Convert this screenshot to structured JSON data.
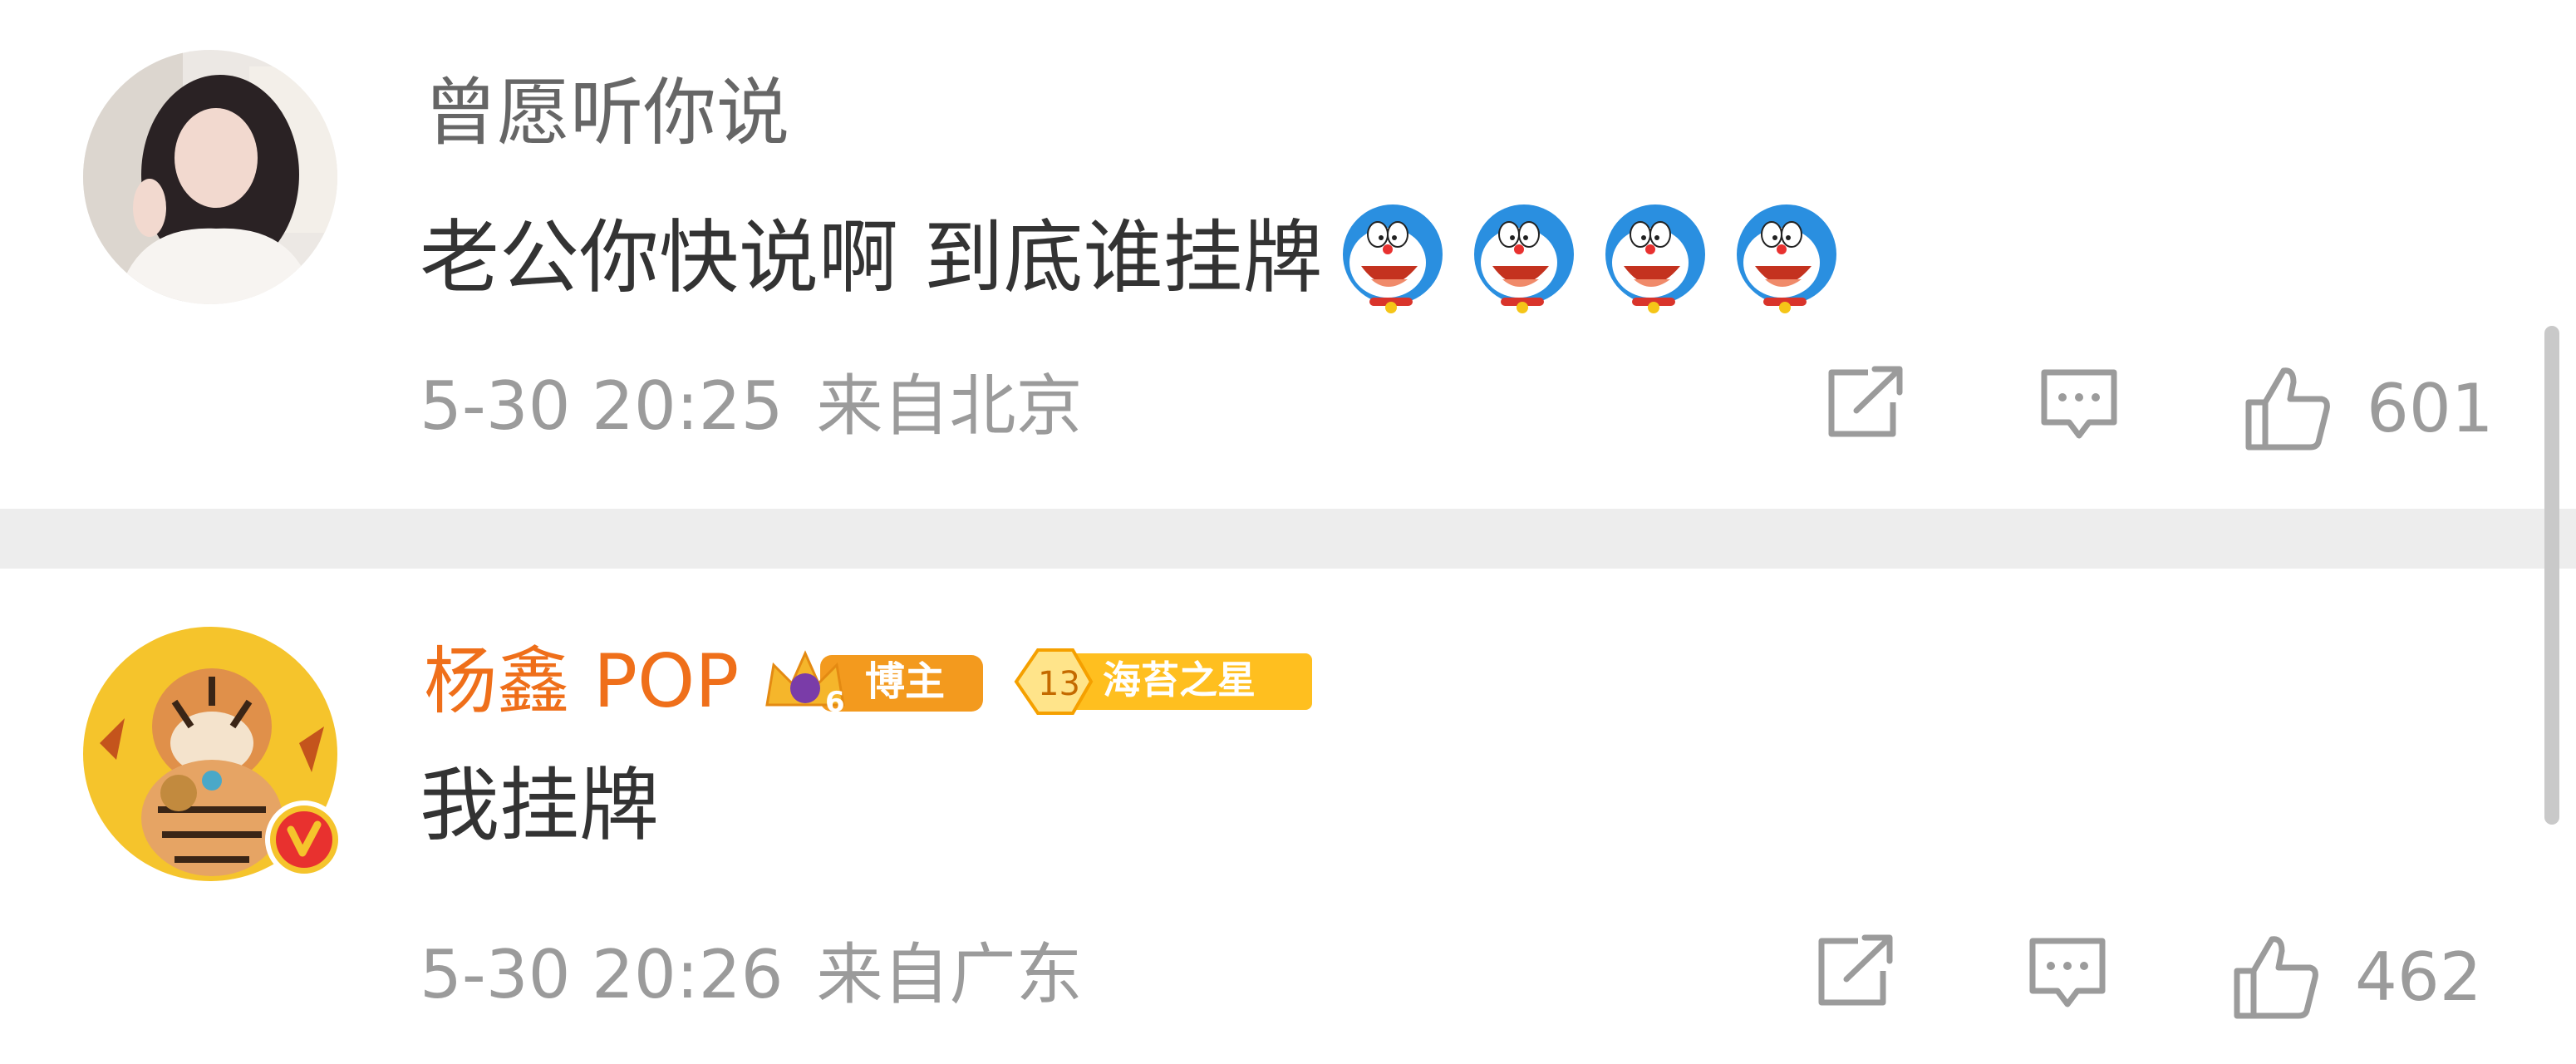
{
  "comments": [
    {
      "username": "曾愿听你说",
      "text": "老公你快说啊 到底谁挂牌",
      "emoji_count": 4,
      "emoji_icon": "doraemon-laughing-emoji",
      "time": "5-30 20:25",
      "location": "来自北京",
      "likes": "601"
    },
    {
      "username": "杨鑫 POP",
      "verified": true,
      "badges": {
        "blogger_level": "6",
        "blogger_label": "博主",
        "star_level": "13",
        "star_label": "海苔之星"
      },
      "text": "我挂牌",
      "time": "5-30 20:26",
      "location": "来自广东",
      "likes": "462"
    }
  ],
  "icons": {
    "share": "share-icon",
    "reply": "comment-icon",
    "like": "thumbs-up-icon",
    "verified": "verified-v-icon"
  },
  "colors": {
    "username_default": "#666666",
    "username_vip": "#ef6f1a",
    "meta": "#9b9b9b",
    "text": "#333333",
    "divider": "#ededed",
    "badge_orange": "#f39a1e",
    "badge_gold": "#ffbf1f",
    "verified_red": "#e8312f"
  }
}
